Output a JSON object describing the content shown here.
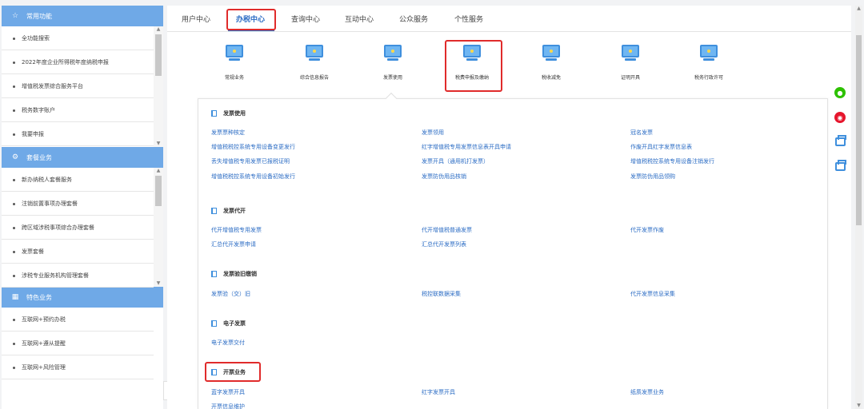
{
  "sidebar": {
    "sections": [
      {
        "title": "常用功能",
        "icon": "star-icon",
        "items": [
          "全功能搜索",
          "2022年度企业所得税年度纳税申报",
          "增值税发票综合服务平台",
          "税务数字账户",
          "我要申报"
        ]
      },
      {
        "title": "套餐业务",
        "icon": "gear-icon",
        "items": [
          "新办纳税人套餐服务",
          "注销前置事项办理套餐",
          "跨区域涉税事项综合办理套餐",
          "发票套餐",
          "涉税专业服务机构管理套餐"
        ]
      },
      {
        "title": "特色业务",
        "icon": "grid-icon",
        "items": [
          "互联网+预约办税",
          "互联网+遵从提醒",
          "互联网+风险管理"
        ]
      }
    ]
  },
  "tabs": [
    "用户中心",
    "办税中心",
    "查询中心",
    "互动中心",
    "公众服务",
    "个性服务"
  ],
  "active_tab": "办税中心",
  "services": [
    "常规业务",
    "综合信息报告",
    "发票使用",
    "税费申报及缴纳",
    "税收减免",
    "证明开具",
    "税务行政许可"
  ],
  "groups": [
    {
      "title": "发票使用",
      "links": [
        [
          "发票票种核定",
          "发票领用",
          "冠名发票"
        ],
        [
          "增值税税控系统专用设备变更发行",
          "红字增值税专用发票信息表开具申请",
          "作废开具红字发票信息表"
        ],
        [
          "丢失增值税专用发票已报税证明",
          "发票开具（通用机打发票）",
          "增值税税控系统专用设备注销发行"
        ],
        [
          "增值税税控系统专用设备初始发行",
          "发票防伪用品核销",
          "发票防伪用品领购"
        ]
      ]
    },
    {
      "title": "发票代开",
      "links": [
        [
          "代开增值税专用发票",
          "代开增值税普通发票",
          "代开发票作废"
        ],
        [
          "汇总代开发票申请",
          "汇总代开发票列表"
        ]
      ]
    },
    {
      "title": "发票验旧缴销",
      "links": [
        [
          "发票验（交）旧",
          "税控联数据采集",
          "代开发票信息采集"
        ]
      ]
    },
    {
      "title": "电子发票",
      "links": [
        [
          "电子发票交付"
        ]
      ]
    },
    {
      "title": "开票业务",
      "links": [
        [
          "蓝字发票开具",
          "红字发票开具",
          "纸质发票业务"
        ],
        [
          "开票信息维护"
        ]
      ]
    }
  ],
  "right_icons": [
    "wechat-icon",
    "weibo-icon",
    "print-icon",
    "print-icon"
  ],
  "colors": {
    "accent": "#2b6cc4",
    "section_header": "#6fa9e7",
    "highlight": "#e02b2b",
    "wechat": "#2dc100",
    "weibo": "#e6162d"
  }
}
